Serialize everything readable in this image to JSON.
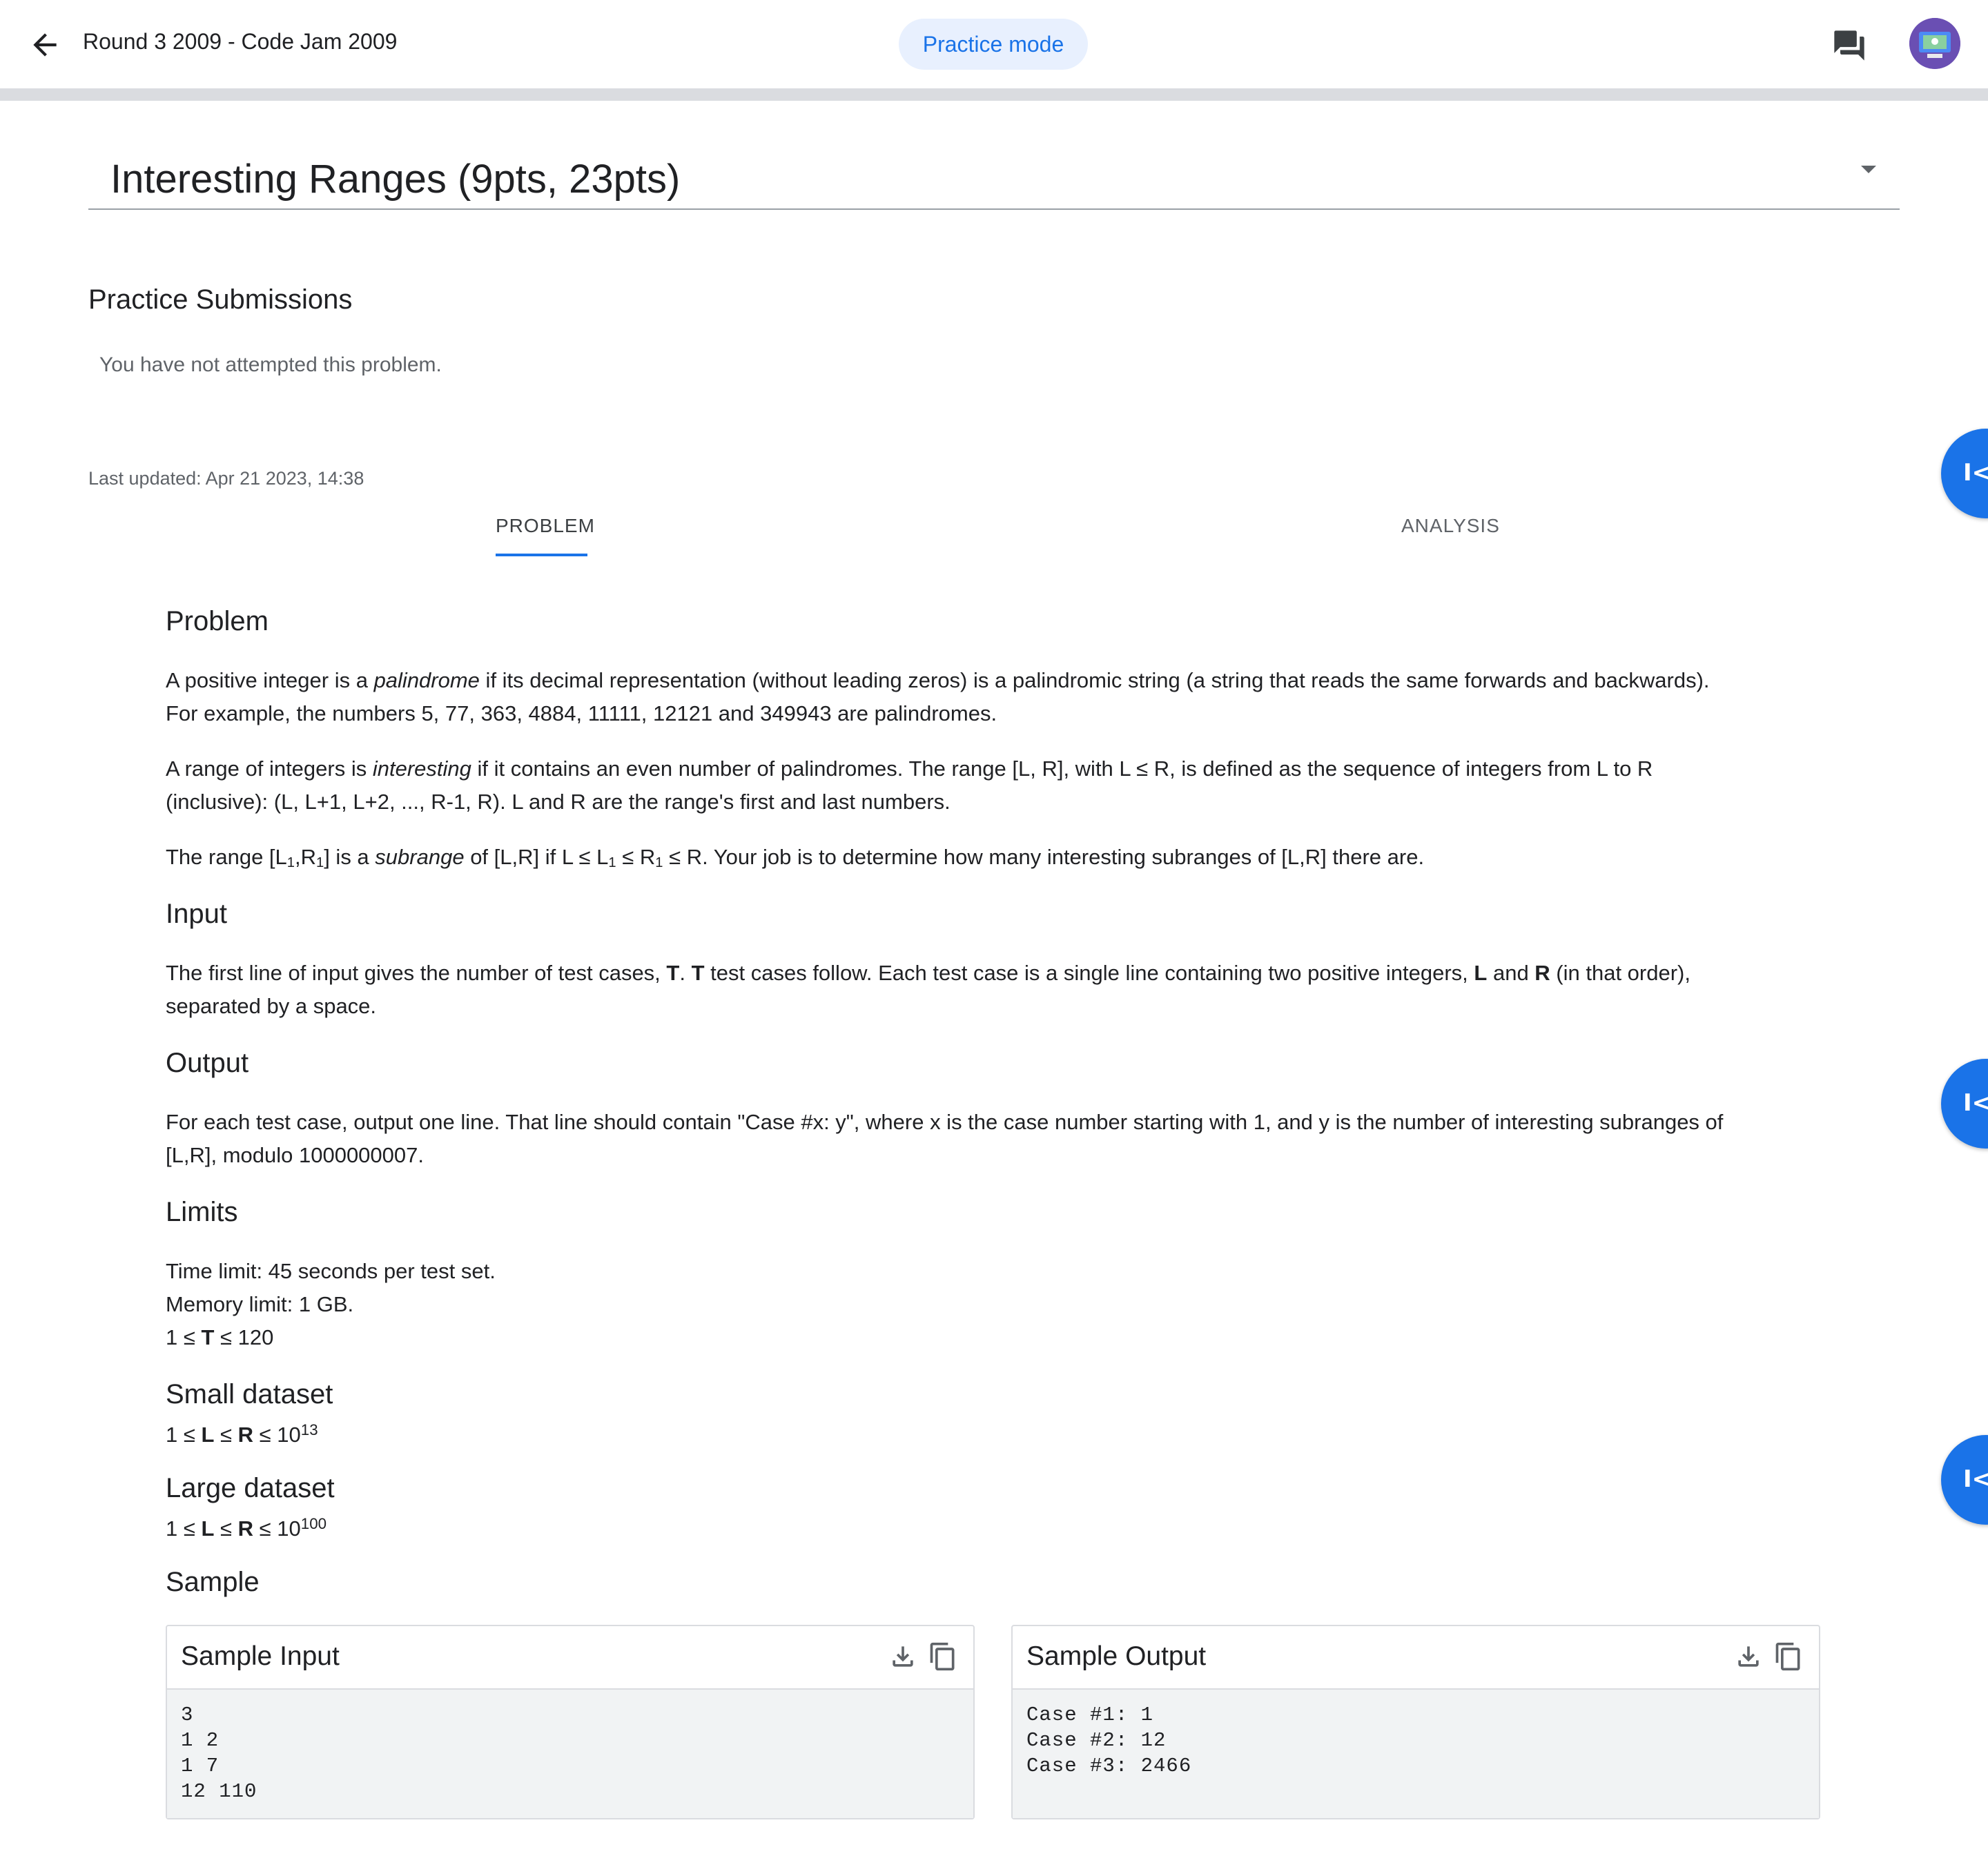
{
  "header": {
    "title": "Round 3 2009 - Code Jam 2009",
    "practice_mode": "Practice mode"
  },
  "problem_select": {
    "title": "Interesting Ranges (9pts, 23pts)"
  },
  "submissions": {
    "heading": "Practice Submissions",
    "empty": "You have not attempted this problem."
  },
  "last_updated": "Last updated: Apr 21 2023, 14:38",
  "tabs": {
    "problem": "PROBLEM",
    "analysis": "ANALYSIS"
  },
  "side_buttons": {
    "glyph": "I<"
  },
  "statement": {
    "problem_heading": "Problem",
    "p1_a": "A positive integer is a ",
    "p1_em": "palindrome",
    "p1_b": " if its decimal representation (without leading zeros) is a palindromic string (a string that reads the same forwards and backwards).",
    "p1_c": "For example, the numbers 5, 77, 363, 4884, 11111, 12121 and 349943 are palindromes.",
    "p2_a": "A range of integers is ",
    "p2_em": "interesting",
    "p2_b": " if it contains an even number of palindromes. The range [L, R], with L ≤ R, is defined as the sequence of integers from L to R",
    "p2_c": "(inclusive): (L, L+1, L+2, ..., R-1, R). L and R are the range's first and last numbers.",
    "p3_a": "The range [L",
    "p3_sub1": "1",
    "p3_b": ",R",
    "p3_sub2": "1",
    "p3_c": "] is a ",
    "p3_em": "subrange",
    "p3_d": " of [L,R] if L ≤ L",
    "p3_sub3": "1",
    "p3_e": " ≤ R",
    "p3_sub4": "1",
    "p3_f": " ≤ R. Your job is to determine how many interesting subranges of [L,R] there are.",
    "input_heading": "Input",
    "in_a": "The first line of input gives the number of test cases, ",
    "in_T1": "T",
    "in_dot": ". ",
    "in_T2": "T",
    "in_b": " test cases follow. Each test case is a single line containing two positive integers, ",
    "in_L": "L",
    "in_and": " and ",
    "in_R": "R",
    "in_c": " (in that order),",
    "in_d": "separated by a space.",
    "output_heading": "Output",
    "out_a": "For each test case, output one line. That line should contain \"Case #x: y\", where x is the case number starting with 1, and y is the number of interesting subranges of",
    "out_b": "[L,R], modulo 1000000007.",
    "limits_heading": "Limits",
    "lim_time": "Time limit: 45 seconds per test set.",
    "lim_mem": "Memory limit: 1 GB.",
    "lim_t_a": "1 ≤ ",
    "lim_t_T": "T",
    "lim_t_b": " ≤ 120",
    "small_heading": "Small dataset",
    "small_a": "1 ≤ ",
    "small_L": "L",
    "small_le": " ≤ ",
    "small_R": "R",
    "small_b": " ≤ 10",
    "small_exp": "13",
    "large_heading": "Large dataset",
    "large_a": "1 ≤ ",
    "large_L": "L",
    "large_le": " ≤ ",
    "large_R": "R",
    "large_b": " ≤ 10",
    "large_exp": "100",
    "sample_heading": "Sample"
  },
  "sample_input": {
    "label": "Sample Input",
    "text": "3\n1 2\n1 7\n12 110"
  },
  "sample_output": {
    "label": "Sample Output",
    "text": "Case #1: 1\nCase #2: 12\nCase #3: 2466"
  },
  "colors": {
    "accent": "#1a73e8",
    "chip_bg": "#e8f0fe",
    "code_bg": "#f1f3f4"
  }
}
